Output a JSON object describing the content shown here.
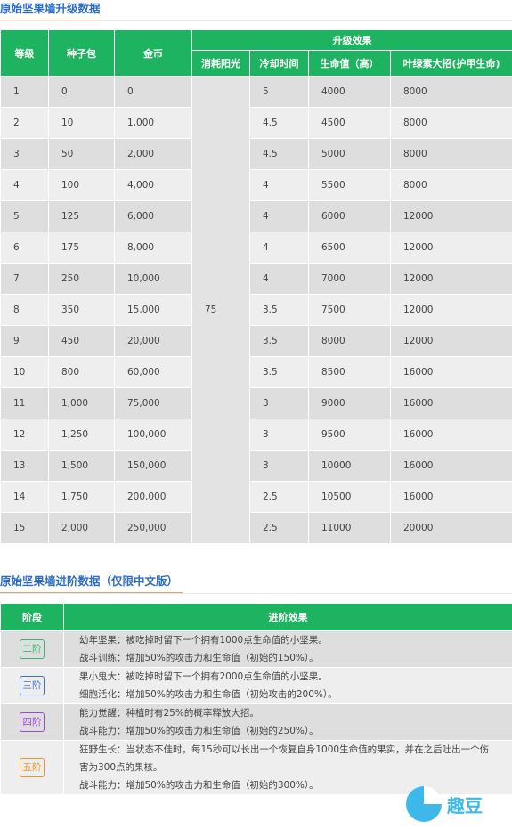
{
  "section1": {
    "title": "原始坚果墙升级数据",
    "headers": {
      "level": "等级",
      "seeds": "种子包",
      "coins": "金币",
      "upgrade_effect": "升级效果",
      "sun_cost": "消耗阳光",
      "cooldown": "冷却时间",
      "health": "生命值（高）",
      "ultimate": "叶绿素大招(护甲生命)"
    },
    "sun_cost_value": "75",
    "rows": [
      {
        "level": "1",
        "seeds": "0",
        "coins": "0",
        "cooldown": "5",
        "health": "4000",
        "ultimate": "8000"
      },
      {
        "level": "2",
        "seeds": "10",
        "coins": "1,000",
        "cooldown": "4.5",
        "health": "4500",
        "ultimate": "8000"
      },
      {
        "level": "3",
        "seeds": "50",
        "coins": "2,000",
        "cooldown": "4.5",
        "health": "5000",
        "ultimate": "8000"
      },
      {
        "level": "4",
        "seeds": "100",
        "coins": "4,000",
        "cooldown": "4",
        "health": "5500",
        "ultimate": "8000"
      },
      {
        "level": "5",
        "seeds": "125",
        "coins": "6,000",
        "cooldown": "4",
        "health": "6000",
        "ultimate": "12000"
      },
      {
        "level": "6",
        "seeds": "175",
        "coins": "8,000",
        "cooldown": "4",
        "health": "6500",
        "ultimate": "12000"
      },
      {
        "level": "7",
        "seeds": "250",
        "coins": "10,000",
        "cooldown": "4",
        "health": "7000",
        "ultimate": "12000"
      },
      {
        "level": "8",
        "seeds": "350",
        "coins": "15,000",
        "cooldown": "3.5",
        "health": "7500",
        "ultimate": "12000"
      },
      {
        "level": "9",
        "seeds": "450",
        "coins": "20,000",
        "cooldown": "3.5",
        "health": "8000",
        "ultimate": "12000"
      },
      {
        "level": "10",
        "seeds": "800",
        "coins": "60,000",
        "cooldown": "3.5",
        "health": "8500",
        "ultimate": "16000"
      },
      {
        "level": "11",
        "seeds": "1,000",
        "coins": "75,000",
        "cooldown": "3",
        "health": "9000",
        "ultimate": "16000"
      },
      {
        "level": "12",
        "seeds": "1,250",
        "coins": "100,000",
        "cooldown": "3",
        "health": "9500",
        "ultimate": "16000"
      },
      {
        "level": "13",
        "seeds": "1,500",
        "coins": "150,000",
        "cooldown": "3",
        "health": "10000",
        "ultimate": "16000"
      },
      {
        "level": "14",
        "seeds": "1,750",
        "coins": "200,000",
        "cooldown": "2.5",
        "health": "10500",
        "ultimate": "16000"
      },
      {
        "level": "15",
        "seeds": "2,000",
        "coins": "250,000",
        "cooldown": "2.5",
        "health": "11000",
        "ultimate": "20000"
      }
    ]
  },
  "section2": {
    "title": "原始坚果墙进阶数据（仅限中文版）",
    "headers": {
      "stage": "阶段",
      "effect": "进阶效果"
    },
    "rows": [
      {
        "stage": "二阶",
        "color": "#3cb371",
        "line1": "幼年坚果：被吃掉时留下一个拥有1000点生命值的小坚果。",
        "line2": "战斗训练：增加50%的攻击力和生命值（初始的150%）。",
        "line3": ""
      },
      {
        "stage": "三阶",
        "color": "#3d6fd6",
        "line1": "果小鬼大：被吃掉时留下一个拥有2000点生命值的小坚果。",
        "line2": "细胞活化：增加50%的攻击力和生命值（初始攻击的200%）。",
        "line3": ""
      },
      {
        "stage": "四阶",
        "color": "#9a4bd6",
        "line1": "能力觉醒：种植时有25%的概率释放大招。",
        "line2": "战斗能力：增加50%的攻击力和生命值（初始的250%）。",
        "line3": ""
      },
      {
        "stage": "五阶",
        "color": "#f0932b",
        "line1": "狂野生长：当状态不佳时，每15秒可以长出一个恢复自身1000生命值的果实，并在之后吐出一个伤",
        "line2": "害为300点的果核。",
        "line3": "战斗能力：增加50%的攻击力和生命值（初始的300%）。"
      }
    ]
  },
  "watermark": {
    "text": "趣豆",
    "color": "#3db8e8"
  }
}
